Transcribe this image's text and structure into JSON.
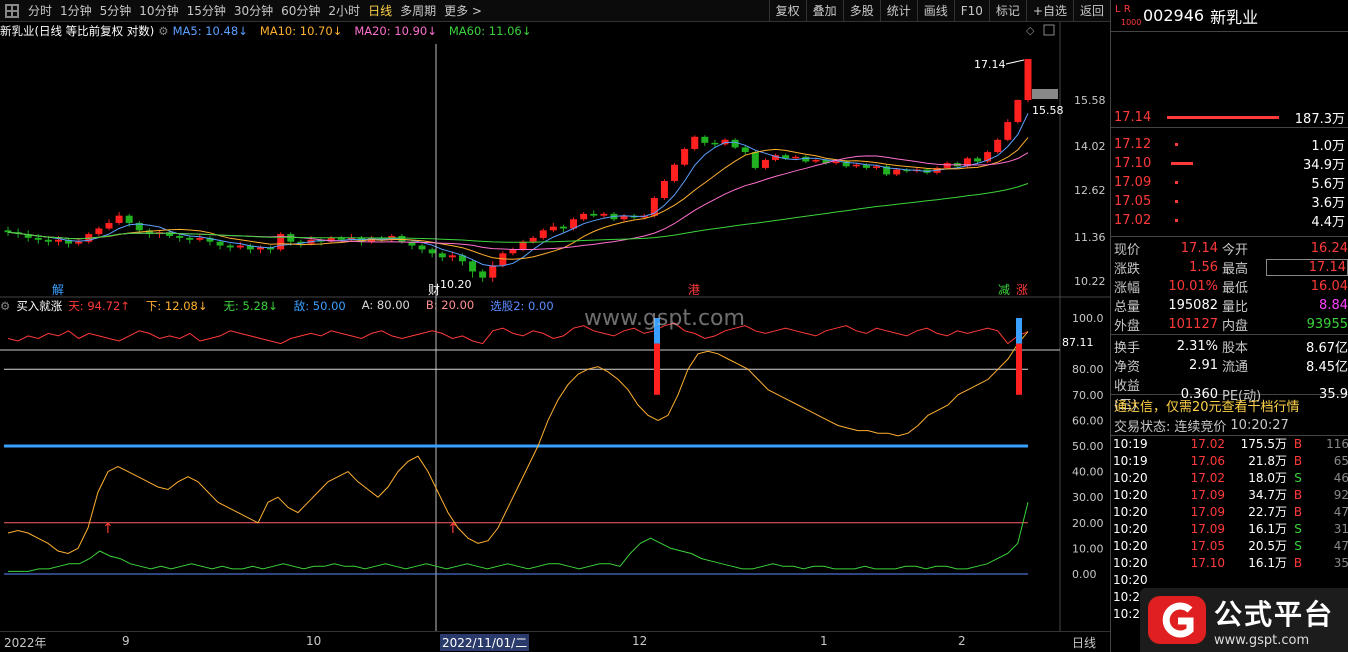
{
  "toolbar": {
    "timeframes": [
      "分时",
      "1分钟",
      "5分钟",
      "10分钟",
      "15分钟",
      "30分钟",
      "60分钟",
      "2小时",
      "日线",
      "多周期",
      "更多 >"
    ],
    "active_timeframe": "日线",
    "right_buttons": [
      "复权",
      "叠加",
      "多股",
      "统计",
      "画线",
      "F10",
      "标记",
      "+自选",
      "返回"
    ]
  },
  "main_chart": {
    "title": "新乳业(日线 等比前复权 对数)",
    "ma": [
      {
        "label": "MA5: 10.48↓",
        "color": "#5aa0ff"
      },
      {
        "label": "MA10: 10.70↓",
        "color": "#ffb030"
      },
      {
        "label": "MA20: 10.90↓",
        "color": "#ff70d0"
      },
      {
        "label": "MA60: 11.06↓",
        "color": "#3bd33b"
      }
    ],
    "y_ticks": [
      "15.58",
      "14.02",
      "12.62",
      "11.36",
      "10.22"
    ],
    "annotations": {
      "high": "17.14",
      "high_price_box": "15.58",
      "low": "10.20"
    },
    "event_markers": [
      "解",
      "财",
      "港",
      "减",
      "涨"
    ]
  },
  "sub_chart": {
    "title": "买入就涨",
    "lines": [
      {
        "label": "天: 94.72↑",
        "color": "#ff3a3a"
      },
      {
        "label": "下: 12.08↓",
        "color": "#ffb030"
      },
      {
        "label": "无: 5.28↓",
        "color": "#3bd33b"
      },
      {
        "label": "敌: 50.00",
        "color": "#3aa0ff"
      },
      {
        "label": "A: 80.00",
        "color": "#d8d8d8"
      },
      {
        "label": "B: 20.00",
        "color": "#ff9090"
      },
      {
        "label": "选股2: 0.00",
        "color": "#5a8cff"
      }
    ],
    "y_ticks": [
      "100.0",
      "80.00",
      "70.00",
      "60.00",
      "50.00",
      "40.00",
      "30.00",
      "20.00",
      "10.00",
      "0.00"
    ],
    "cursor_value": "87.11",
    "watermark": "www.gspt.com"
  },
  "date_axis": {
    "labels": [
      "2022年",
      "9",
      "10",
      "2022/11/01/二",
      "12",
      "1",
      "2"
    ],
    "period": "日线"
  },
  "stock": {
    "flags": "L R",
    "sub_flag": "1000",
    "code": "002946",
    "name": "新乳业"
  },
  "order_book": {
    "sell": [
      {
        "price": "17.14",
        "vol": "187.3万"
      }
    ],
    "buy": [
      {
        "price": "17.12",
        "vol": "1.0万"
      },
      {
        "price": "17.10",
        "vol": "34.9万"
      },
      {
        "price": "17.09",
        "vol": "5.6万"
      },
      {
        "price": "17.05",
        "vol": "3.6万"
      },
      {
        "price": "17.02",
        "vol": "4.4万"
      }
    ]
  },
  "quote": {
    "rows": [
      {
        "l1": "现价",
        "v1": "17.14",
        "l2": "今开",
        "v2": "16.24"
      },
      {
        "l1": "涨跌",
        "v1": "1.56",
        "l2": "最高",
        "v2": "17.14"
      },
      {
        "l1": "涨幅",
        "v1": "10.01%",
        "l2": "最低",
        "v2": "16.04"
      },
      {
        "l1": "总量",
        "v1": "195082",
        "l2": "量比",
        "v2": "8.84"
      },
      {
        "l1": "外盘",
        "v1": "101127",
        "l2": "内盘",
        "v2": "93955"
      }
    ],
    "rows2": [
      {
        "l1": "换手",
        "v1": "2.31%",
        "l2": "股本",
        "v2": "8.67亿"
      },
      {
        "l1": "净资",
        "v1": "2.91",
        "l2": "流通",
        "v2": "8.45亿"
      },
      {
        "l1": "收益(三)",
        "v1": "0.360",
        "l2": "PE(动)",
        "v2": "35.9"
      }
    ]
  },
  "promo": "通达信，仅需20元查看千档行情",
  "trade_status": {
    "label": "交易状态:",
    "value": "连续竞价",
    "time": "10:20:27"
  },
  "ticks": [
    {
      "time": "10:19",
      "price": "17.02",
      "vol": "175.5万",
      "bs": "B",
      "n": "116"
    },
    {
      "time": "10:19",
      "price": "17.06",
      "vol": "21.8万",
      "bs": "B",
      "n": "65"
    },
    {
      "time": "10:20",
      "price": "17.02",
      "vol": "18.0万",
      "bs": "S",
      "n": "46"
    },
    {
      "time": "10:20",
      "price": "17.09",
      "vol": "34.7万",
      "bs": "B",
      "n": "92"
    },
    {
      "time": "10:20",
      "price": "17.09",
      "vol": "22.7万",
      "bs": "B",
      "n": "47"
    },
    {
      "time": "10:20",
      "price": "17.09",
      "vol": "16.1万",
      "bs": "S",
      "n": "31"
    },
    {
      "time": "10:20",
      "price": "17.05",
      "vol": "20.5万",
      "bs": "S",
      "n": "47"
    },
    {
      "time": "10:20",
      "price": "17.10",
      "vol": "16.1万",
      "bs": "B",
      "n": "35"
    },
    {
      "time": "10:20",
      "price": "",
      "vol": "",
      "bs": "",
      "n": ""
    },
    {
      "time": "10:2",
      "price": "",
      "vol": "",
      "bs": "",
      "n": ""
    },
    {
      "time": "10:2",
      "price": "",
      "vol": "",
      "bs": "",
      "n": ""
    }
  ],
  "logo": {
    "title": "公式平台",
    "url": "www.gspt.com"
  },
  "colors": {
    "up": "#ff3a3a",
    "down": "#3bd33b",
    "bg": "#000000",
    "accent": "#3aa0ff"
  }
}
